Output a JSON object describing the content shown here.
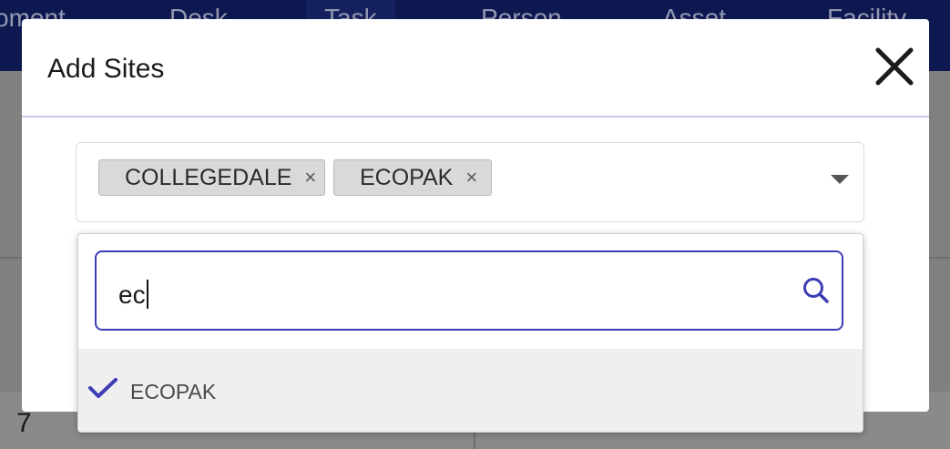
{
  "background": {
    "nav_items": [
      "oment",
      "Desk",
      "Task",
      "Person",
      "Asset",
      "Facility"
    ],
    "row_number": "7"
  },
  "modal": {
    "title": "Add Sites",
    "selected_chips": [
      {
        "label": "COLLEGEDALE",
        "remove": "×"
      },
      {
        "label": "ECOPAK",
        "remove": "×"
      }
    ],
    "search": {
      "value": "ec"
    },
    "options": [
      {
        "label": "ECOPAK",
        "checked": true
      }
    ]
  },
  "colors": {
    "accent": "#3d3db5",
    "nav_bg": "#0d1850"
  },
  "icons": {
    "close": "close-icon",
    "search": "search-icon",
    "check": "check-icon",
    "dropdown": "chevron-down-icon"
  }
}
